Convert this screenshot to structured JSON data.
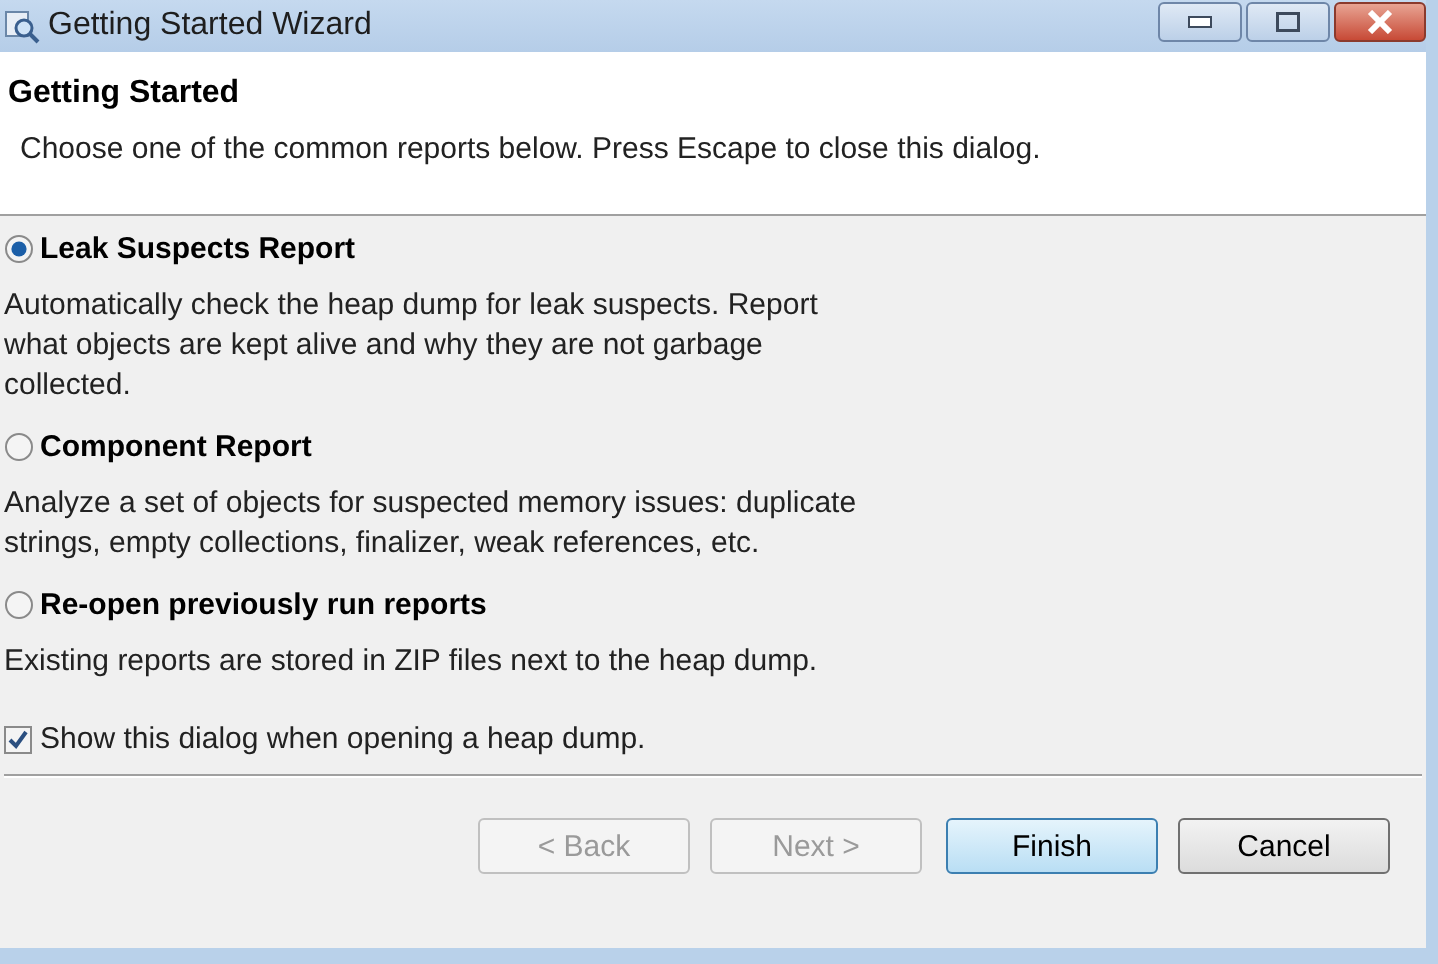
{
  "window": {
    "title": "Getting Started Wizard"
  },
  "header": {
    "title": "Getting Started",
    "message": "Choose one of the common reports below. Press Escape to close this dialog."
  },
  "options": [
    {
      "label": "Leak Suspects Report",
      "selected": true,
      "description": "Automatically check the heap dump for leak suspects. Report what objects are kept alive and why they are not garbage collected."
    },
    {
      "label": "Component Report",
      "selected": false,
      "description": "Analyze a set of objects for suspected memory issues: duplicate strings, empty collections, finalizer, weak references, etc."
    },
    {
      "label": "Re-open previously run reports",
      "selected": false,
      "description": "Existing reports are stored in ZIP files next to the heap dump."
    }
  ],
  "show_dialog": {
    "label": "Show this dialog when opening a heap dump.",
    "checked": true
  },
  "buttons": [
    {
      "label": "< Back",
      "disabled": true,
      "default": false
    },
    {
      "label": "Next >",
      "disabled": true,
      "default": false
    },
    {
      "label": "Finish",
      "disabled": false,
      "default": true
    },
    {
      "label": "Cancel",
      "disabled": false,
      "default": false
    }
  ]
}
